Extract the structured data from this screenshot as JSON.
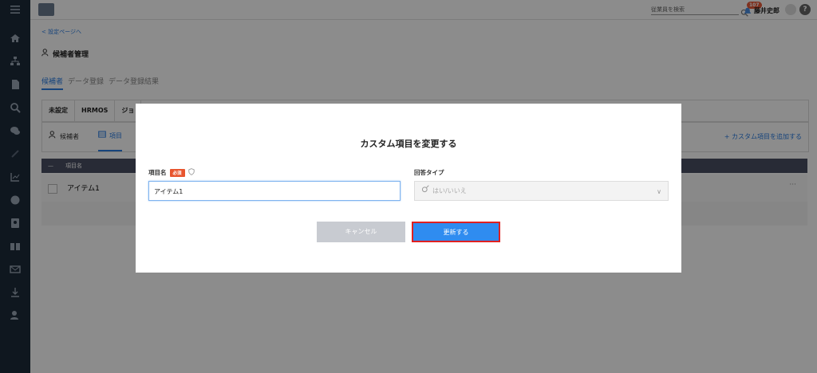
{
  "topbar": {
    "search_placeholder": "従業員を検索",
    "notif_count": "107",
    "user_name": "藤井史郎",
    "help_label": "?"
  },
  "page": {
    "back_link": "< 設定ページへ",
    "title": "候補者管理",
    "tabs": [
      "候補者",
      "データ登録",
      "データ登録結果"
    ]
  },
  "filters": [
    "未設定",
    "HRMOS",
    "ジョ"
  ],
  "subtabs": {
    "candidates": "候補者",
    "items": "項目",
    "add_custom": "+ カスタム項目を追加する"
  },
  "table": {
    "header": "項目名",
    "row_name": "アイテム1",
    "row_menu": "···"
  },
  "modal": {
    "title": "カスタム項目を変更する",
    "name_label": "項目名",
    "required_badge": "必須",
    "name_value": "アイテム1",
    "type_label": "回答タイプ",
    "type_value": "はい/いいえ",
    "cancel_label": "キャンセル",
    "update_label": "更新する"
  },
  "colors": {
    "sidebar": "#1c2a3a",
    "accent": "#2a7de1",
    "update_button": "#2f8cf0",
    "update_outline": "#e02020",
    "required_badge": "#e8552e"
  }
}
